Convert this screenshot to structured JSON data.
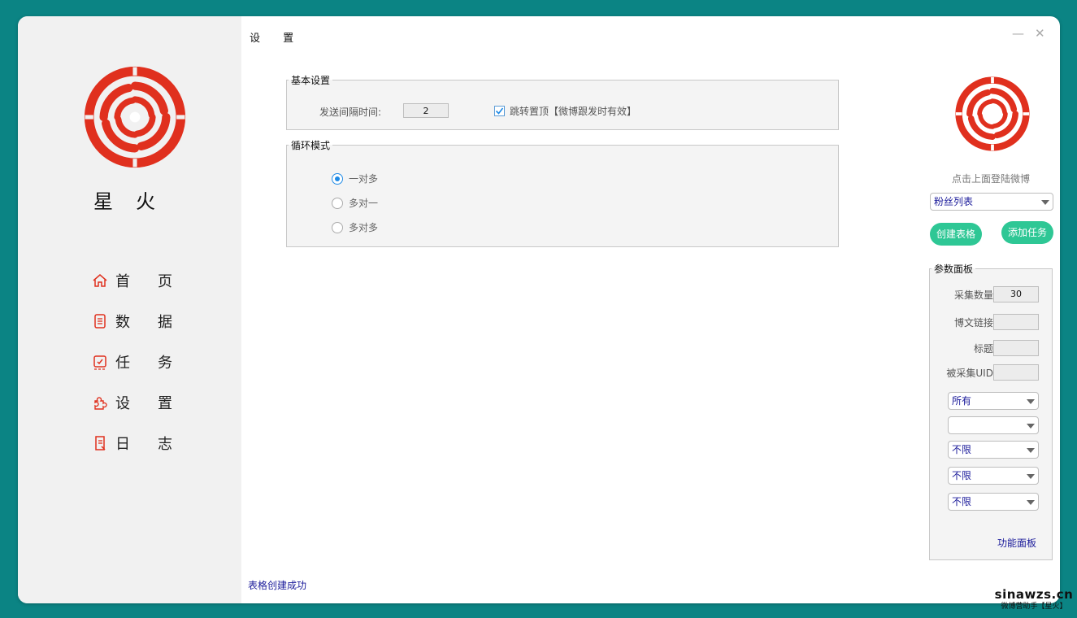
{
  "app": {
    "name": "星火"
  },
  "nav": [
    {
      "label": "首页",
      "icon": "home-icon"
    },
    {
      "label": "数据",
      "icon": "document-icon"
    },
    {
      "label": "任务",
      "icon": "task-icon"
    },
    {
      "label": "设置",
      "icon": "puzzle-icon"
    },
    {
      "label": "日志",
      "icon": "log-icon"
    }
  ],
  "page": {
    "title": "设 置"
  },
  "basic_settings": {
    "legend": "基本设置",
    "interval_label": "发送间隔时间:",
    "interval_value": "2",
    "jump_checkbox_label": "跳转置顶【微博跟发时有效】",
    "jump_checked": true
  },
  "loop_mode": {
    "legend": "循环模式",
    "options": [
      "一对多",
      "多对一",
      "多对多"
    ],
    "selected": "一对多"
  },
  "status": {
    "message": "表格创建成功"
  },
  "right_panel": {
    "login_hint": "点击上面登陆微博",
    "fans_select": "粉丝列表",
    "create_table_button": "创建表格",
    "add_task_button": "添加任务",
    "params": {
      "legend": "参数面板",
      "collect_count_label": "采集数量:",
      "collect_count_value": "30",
      "post_link_label": "博文链接:",
      "post_link_value": "",
      "title_label": "标题:",
      "title_value": "",
      "uid_label": "被采集UID:",
      "uid_value": "",
      "selects": [
        "所有",
        "",
        "不限",
        "不限",
        "不限"
      ],
      "func_link": "功能面板"
    }
  },
  "watermark": {
    "main": "sinawzs.cn",
    "sub": "微博营助手【星火】"
  },
  "colors": {
    "accent_red": "#e0301e",
    "green": "#2ec795",
    "teal_bg": "#0b8484",
    "link_blue": "#1a1a9a"
  }
}
